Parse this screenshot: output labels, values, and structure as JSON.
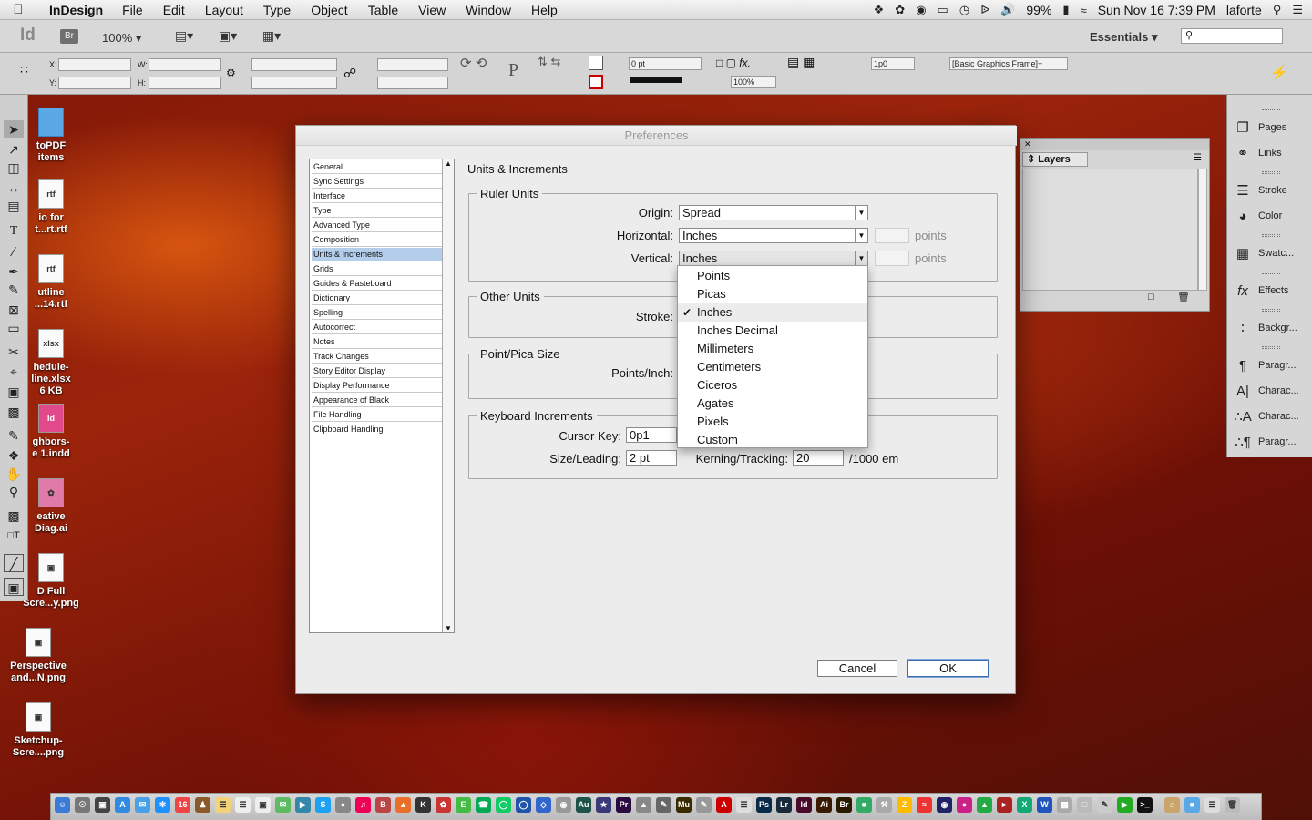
{
  "menubar": {
    "app": "InDesign",
    "items": [
      "File",
      "Edit",
      "Layout",
      "Type",
      "Object",
      "Table",
      "View",
      "Window",
      "Help"
    ],
    "battery": "99%",
    "clock": "Sun Nov 16  7:39 PM",
    "user": "laforte"
  },
  "appbar": {
    "logo": "Id",
    "bridge": "Br",
    "zoom": "100%",
    "workspace": "Essentials"
  },
  "control": {
    "x_label": "X:",
    "y_label": "Y:",
    "w_label": "W:",
    "h_label": "H:",
    "stroke_weight": "0 pt",
    "scale": "100%",
    "gap": "1p0",
    "object_style": "[Basic Graphics Frame]+"
  },
  "desktop": [
    {
      "name": "toPDF\nitems",
      "type": "folder"
    },
    {
      "name": "io for\nt...rt.rtf",
      "type": "rtf"
    },
    {
      "name": "utline\n...14.rtf",
      "type": "rtf"
    },
    {
      "name": "hedule-\nline.xlsx\n6 KB",
      "type": "xlsx"
    },
    {
      "name": "ghbors-\ne 1.indd",
      "type": "indd"
    },
    {
      "name": "eative\nDiag.ai",
      "type": "ai"
    },
    {
      "name": "D Full\nScre...y.png",
      "type": "png"
    },
    {
      "name": "Perspective\nand...N.png",
      "type": "png"
    },
    {
      "name": "Sketchup-\nScre....png",
      "type": "png"
    }
  ],
  "panels": {
    "items": [
      "Pages",
      "Links",
      "Stroke",
      "Color",
      "Swatc...",
      "Effects",
      "Backgr...",
      "Paragr...",
      "Charac...",
      "Charac...",
      "Paragr..."
    ],
    "layers_title": "Layers"
  },
  "dialog": {
    "title": "Preferences",
    "nav": [
      "General",
      "Sync Settings",
      "Interface",
      "Type",
      "Advanced Type",
      "Composition",
      "Units & Increments",
      "Grids",
      "Guides & Pasteboard",
      "Dictionary",
      "Spelling",
      "Autocorrect",
      "Notes",
      "Track Changes",
      "Story Editor Display",
      "Display Performance",
      "Appearance of Black",
      "File Handling",
      "Clipboard Handling"
    ],
    "selected_nav": "Units & Increments",
    "heading": "Units & Increments",
    "ruler": {
      "label": "Ruler Units",
      "origin_label": "Origin:",
      "origin": "Spread",
      "horizontal_label": "Horizontal:",
      "horizontal": "Inches",
      "vertical_label": "Vertical:",
      "vertical": "Inches",
      "points": "points"
    },
    "other": {
      "label": "Other Units",
      "stroke_label": "Stroke:"
    },
    "pointpica": {
      "label": "Point/Pica Size",
      "points_inch_label": "Points/Inch:"
    },
    "keyboard": {
      "label": "Keyboard Increments",
      "cursor_label": "Cursor Key:",
      "cursor": "0p1",
      "size_label": "Size/Leading:",
      "size": "2 pt",
      "kern_label": "Kerning/Tracking:",
      "kern": "20",
      "kern_unit": "/1000 em"
    },
    "dropdown": [
      "Points",
      "Picas",
      "Inches",
      "Inches Decimal",
      "Millimeters",
      "Centimeters",
      "Ciceros",
      "Agates",
      "Pixels",
      "Custom"
    ],
    "dropdown_checked": "Inches",
    "cancel": "Cancel",
    "ok": "OK"
  }
}
